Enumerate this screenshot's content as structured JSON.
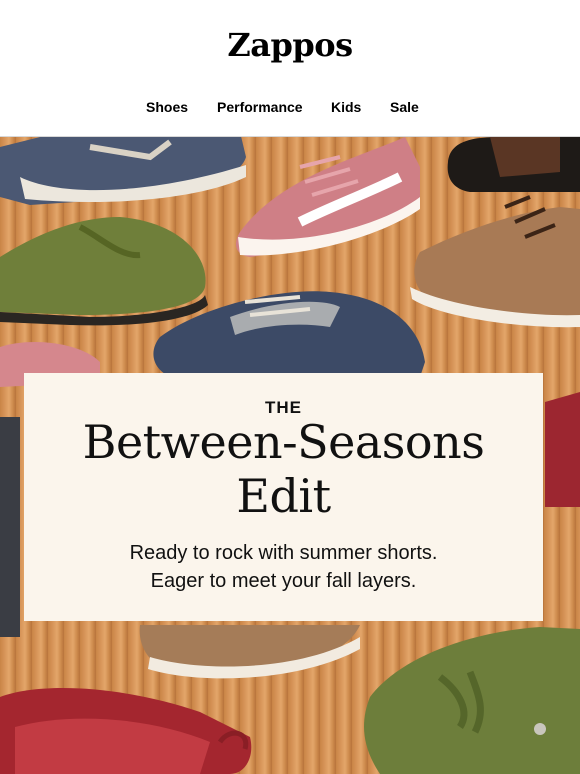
{
  "brand": {
    "logo_text": "Zappos"
  },
  "nav": {
    "items": [
      {
        "label": "Shoes"
      },
      {
        "label": "Performance"
      },
      {
        "label": "Kids"
      },
      {
        "label": "Sale"
      }
    ]
  },
  "hero": {
    "image_name": "shoes-on-wood-slats-photo",
    "eyebrow": "THE",
    "headline_line1": "Between-Seasons",
    "headline_line2": "Edit",
    "subtext_line1": "Ready to rock with summer shorts.",
    "subtext_line2": "Eager to meet your fall layers."
  },
  "colors": {
    "wood": "#d8965a",
    "card_background": "#fbf5ec",
    "text": "#111111"
  }
}
